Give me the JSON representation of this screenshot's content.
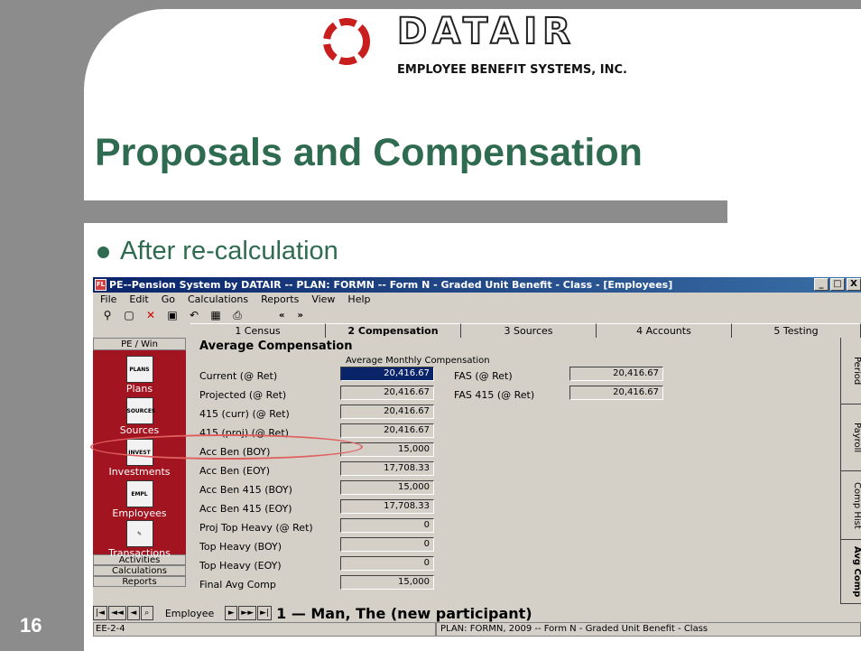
{
  "slide": {
    "logo_word": "DATAIR",
    "logo_sub": "EMPLOYEE BENEFIT SYSTEMS, INC.",
    "title": "Proposals and Compensation",
    "bullet": "After re-calculation",
    "page_number": "16"
  },
  "app": {
    "icon_label": "FL",
    "title": "PE--Pension System by DATAIR -- PLAN: FORMN -- Form N - Graded Unit Benefit - Class - [Employees]",
    "window_buttons": [
      "_",
      "□",
      "X"
    ],
    "menu": [
      "File",
      "Edit",
      "Go",
      "Calculations",
      "Reports",
      "View",
      "Help"
    ],
    "toolbar_icons": [
      "binoculars-icon",
      "new-icon",
      "delete-icon",
      "save-icon",
      "undo-icon",
      "calculator-icon",
      "print-icon"
    ],
    "nav_prev": "«",
    "nav_next": "»",
    "tabs": [
      "1 Census",
      "2 Compensation",
      "3 Sources",
      "4 Accounts",
      "5 Testing"
    ],
    "active_tab": "2 Compensation"
  },
  "sidebar": {
    "header": "PE / Win",
    "items": [
      {
        "icon_text": "PLANS",
        "label": "Plans"
      },
      {
        "icon_text": "SOURCES",
        "label": "Sources"
      },
      {
        "icon_text": "INVEST",
        "label": "Investments"
      },
      {
        "icon_text": "EMPL",
        "label": "Employees"
      },
      {
        "icon_text": "",
        "label": "Transactions"
      }
    ],
    "bottom": [
      "Activities",
      "Calculations",
      "Reports"
    ]
  },
  "main": {
    "heading": "Average Compensation",
    "column_header": "Average Monthly Compensation",
    "rows": [
      {
        "label": "Current (@ Ret)",
        "value": "20,416.67"
      },
      {
        "label": "Projected (@ Ret)",
        "value": "20,416.67"
      },
      {
        "label": "415 (curr) (@ Ret)",
        "value": "20,416.67"
      },
      {
        "label": "415 (proj) (@ Ret)",
        "value": "20,416.67"
      },
      {
        "label": "Acc Ben (BOY)",
        "value": "15,000"
      },
      {
        "label": "Acc Ben (EOY)",
        "value": "17,708.33"
      },
      {
        "label": "Acc Ben 415 (BOY)",
        "value": "15,000"
      },
      {
        "label": "Acc Ben 415 (EOY)",
        "value": "17,708.33"
      },
      {
        "label": "Proj Top Heavy (@ Ret)",
        "value": "0"
      },
      {
        "label": "Top Heavy (BOY)",
        "value": "0"
      },
      {
        "label": "Top Heavy (EOY)",
        "value": "0"
      },
      {
        "label": "Final Avg Comp",
        "value": "15,000"
      }
    ],
    "right_rows": [
      {
        "label": "FAS (@ Ret)",
        "value": "20,416.67"
      },
      {
        "label": "FAS 415 (@ Ret)",
        "value": "20,416.67"
      }
    ]
  },
  "vertical_tabs": [
    "Period",
    "Payroll",
    "Comp Hist",
    "Avg Comp"
  ],
  "navigation": {
    "buttons": [
      "|◄",
      "◄◄",
      "◄",
      "⌕"
    ],
    "record_label": "Employee",
    "buttons_right": [
      "►",
      "►►",
      "►|"
    ],
    "current_record": "1  —  Man, The (new participant)"
  },
  "status": {
    "left": "EE-2-4",
    "right": "PLAN: FORMN,  2009 -- Form N - Graded Unit Benefit - Class"
  }
}
